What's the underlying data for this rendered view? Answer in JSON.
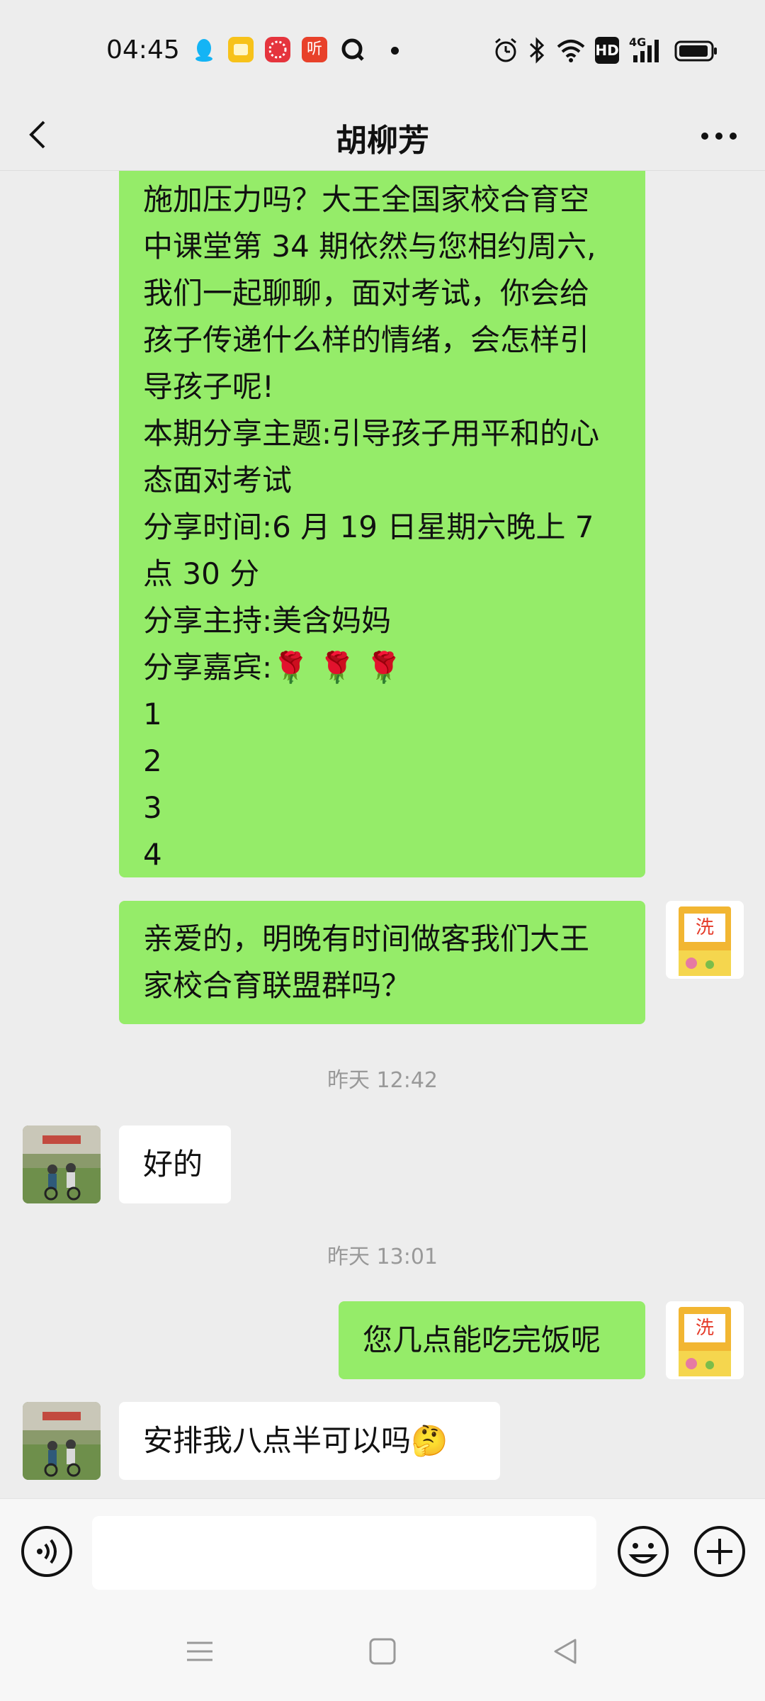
{
  "status_bar": {
    "time": "04:45",
    "notif_listen_label": "听",
    "icons": [
      "qq-icon",
      "notes-icon",
      "gift-icon",
      "listen-icon",
      "q-icon",
      "dot-icon",
      "alarm-icon",
      "bluetooth-icon",
      "wifi-icon",
      "hd-icon",
      "4g-signal-icon",
      "battery-icon"
    ],
    "hd_label": "HD",
    "network_label": "4G"
  },
  "header": {
    "title": "胡柳芳",
    "back_icon": "chevron-left-icon",
    "more_icon": "more-dots-icon"
  },
  "chat": {
    "messages": [
      {
        "side": "right",
        "lines": [
          "施加压力吗？大王全国家校合育空",
          "中课堂第 34 期依然与您相约周六,",
          "我们一起聊聊，面对考试，你会给",
          "孩子传递什么样的情绪，会怎样引",
          "导孩子呢!",
          "本期分享主题:引导孩子用平和的心",
          "态面对考试",
          "分享时间:6 月 19 日星期六晚上 7",
          "点 30 分",
          "分享主持:美含妈妈",
          "分享嘉宾:🌹 🌹 🌹",
          "1",
          "2",
          "3",
          "4"
        ]
      },
      {
        "side": "right",
        "lines": [
          "亲爱的，明晚有时间做客我们大王",
          "家校合育联盟群吗？"
        ]
      },
      {
        "timestamp": "昨天 12:42"
      },
      {
        "side": "left",
        "text": "好的"
      },
      {
        "timestamp": "昨天 13:01"
      },
      {
        "side": "right",
        "text": "您几点能吃完饭呢"
      },
      {
        "side": "left",
        "text": "安排我八点半可以吗🤔"
      }
    ]
  },
  "input_bar": {
    "voice_icon": "voice-icon",
    "emoji_icon": "emoji-icon",
    "plus_icon": "plus-icon",
    "text_value": ""
  },
  "nav_bar": {
    "icons": [
      "menu-icon",
      "home-icon",
      "back-triangle-icon"
    ]
  },
  "colors": {
    "background": "#ededed",
    "bubble_green": "#95ec69",
    "bubble_white": "#ffffff",
    "timestamp_text": "#999999"
  }
}
